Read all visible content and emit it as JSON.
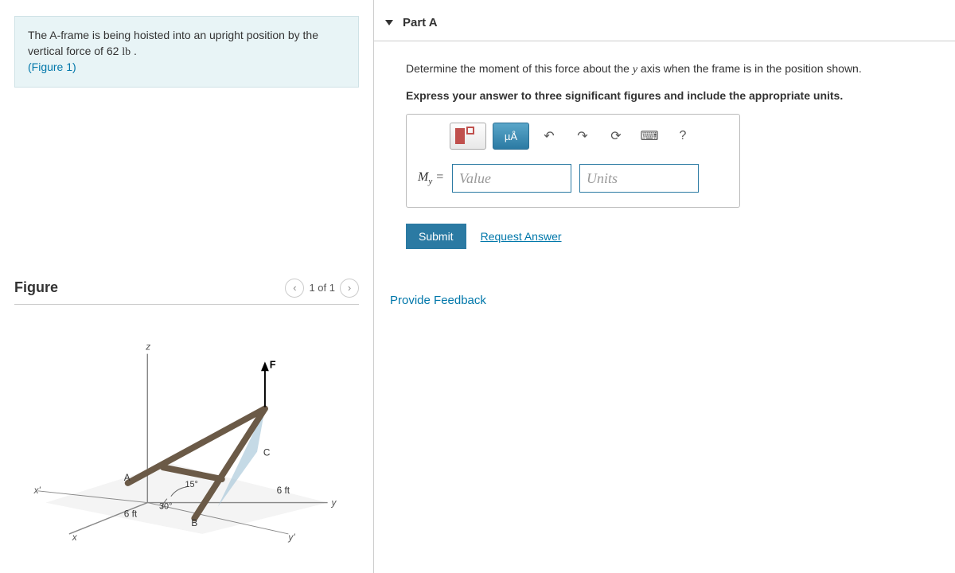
{
  "problem": {
    "text_before": "The A-frame is being hoisted into an upright position by the vertical force of 62 ",
    "unit": "lb",
    "text_after": " .",
    "figure_ref": "(Figure 1)"
  },
  "figure": {
    "title": "Figure",
    "nav_label": "1 of 1",
    "labels": {
      "z": "z",
      "x": "x",
      "y": "y",
      "xprime": "x'",
      "yprime": "y'",
      "F": "F",
      "A": "A",
      "B": "B",
      "C": "C",
      "angle15": "15°",
      "angle30": "30°",
      "len_left": "6 ft",
      "len_right": "6 ft"
    }
  },
  "part": {
    "title": "Part A",
    "question_before": "Determine the moment of this force about the ",
    "question_var": "y",
    "question_after": " axis when the frame is in the position shown.",
    "instructions": "Express your answer to three significant figures and include the appropriate units.",
    "toolbar": {
      "units_btn": "µÅ",
      "help": "?"
    },
    "answer": {
      "label_prefix": "M",
      "label_sub": "y",
      "equals": " = ",
      "value_placeholder": "Value",
      "units_placeholder": "Units"
    },
    "submit": "Submit",
    "request_answer": "Request Answer"
  },
  "feedback_link": "Provide Feedback"
}
